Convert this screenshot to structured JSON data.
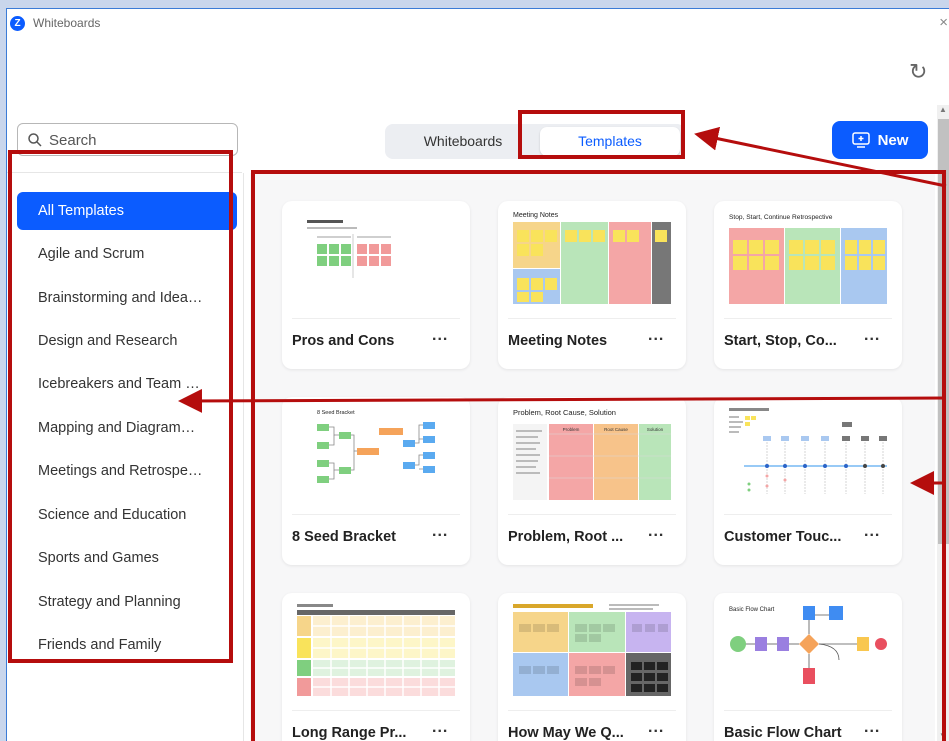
{
  "window": {
    "title": "Whiteboards",
    "close_glyph": "×"
  },
  "search": {
    "placeholder": "Search"
  },
  "tabs": {
    "whiteboards": "Whiteboards",
    "templates": "Templates"
  },
  "new_button": {
    "label": "New"
  },
  "categories": [
    "All Templates",
    "Agile and Scrum",
    "Brainstorming and Idea…",
    "Design and Research",
    "Icebreakers and Team …",
    "Mapping and Diagram…",
    "Meetings and Retrospe…",
    "Science and Education",
    "Sports and Games",
    "Strategy and Planning",
    "Friends and Family"
  ],
  "templates": [
    {
      "name": "Pros and Cons",
      "more": "..."
    },
    {
      "name": "Meeting Notes",
      "more": "..."
    },
    {
      "name": "Start, Stop, Co...",
      "more": "..."
    },
    {
      "name": "8 Seed Bracket",
      "more": "..."
    },
    {
      "name": "Problem, Root ...",
      "more": "..."
    },
    {
      "name": "Customer Touc...",
      "more": "..."
    },
    {
      "name": "Long Range Pr...",
      "more": "..."
    },
    {
      "name": "How May We Q...",
      "more": "..."
    },
    {
      "name": "Basic Flow Chart",
      "more": "..."
    }
  ],
  "thumbnail_text": {
    "meeting_notes": "Meeting Notes",
    "retro": "Stop, Start, Continue Retrospective",
    "seed_bracket": "8 Seed Bracket",
    "problem": "Problem, Root Cause, Solution",
    "problem_cols": [
      "Problem",
      "Root Cause",
      "Solution"
    ],
    "flow": "Basic Flow Chart"
  },
  "colors": {
    "accent": "#0b5cff",
    "annotation": "#b50d0d"
  }
}
